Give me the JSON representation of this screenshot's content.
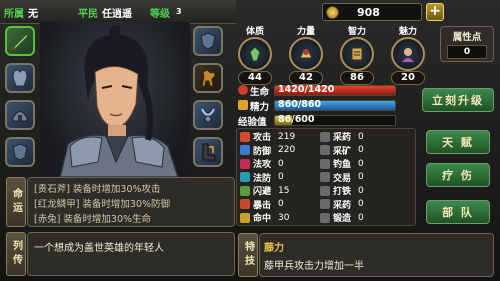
{
  "header": {
    "faction_label": "所属",
    "faction_value": "无",
    "rank_label": "平民",
    "title_value": "任逍遥",
    "level_label": "等级",
    "level_value": "3"
  },
  "currency": {
    "amount": "908",
    "add_label": "+"
  },
  "equipment_slots_left": [
    "weapon-icon",
    "armor-icon",
    "helmet-icon",
    "shield-icon"
  ],
  "equipment_slots_right": [
    "shield-icon",
    "horse-icon",
    "necklace-icon",
    "boots-icon"
  ],
  "attributes": [
    {
      "name": "体质",
      "value": "44"
    },
    {
      "name": "力量",
      "value": "42"
    },
    {
      "name": "智力",
      "value": "86"
    },
    {
      "name": "魅力",
      "value": "20"
    }
  ],
  "attr_points": {
    "label": "属性点",
    "value": "0"
  },
  "vitals": {
    "hp": {
      "label": "生命",
      "text": "1420/1420",
      "fraction": 1.0
    },
    "energy": {
      "label": "精力",
      "text": "860/860",
      "fraction": 1.0
    },
    "exp": {
      "label": "经验值",
      "text": "86/600",
      "fraction": 0.143
    }
  },
  "stats": [
    {
      "label": "攻击",
      "value": "219",
      "color": "#d24a2c"
    },
    {
      "label": "采药",
      "value": "0",
      "color": "#6a6a6a"
    },
    {
      "label": "防御",
      "value": "220",
      "color": "#3b7bd3"
    },
    {
      "label": "采矿",
      "value": "0",
      "color": "#6a6a6a"
    },
    {
      "label": "法攻",
      "value": "0",
      "color": "#c92a5a"
    },
    {
      "label": "钓鱼",
      "value": "0",
      "color": "#6a6a6a"
    },
    {
      "label": "法防",
      "value": "0",
      "color": "#2a9ab0"
    },
    {
      "label": "交易",
      "value": "0",
      "color": "#6a6a6a"
    },
    {
      "label": "闪避",
      "value": "15",
      "color": "#5a9c3a"
    },
    {
      "label": "打铁",
      "value": "0",
      "color": "#6a6a6a"
    },
    {
      "label": "暴击",
      "value": "0",
      "color": "#c94a2a"
    },
    {
      "label": "采药",
      "value": "0",
      "color": "#6a6a6a"
    },
    {
      "label": "命中",
      "value": "30",
      "color": "#c9a22a"
    },
    {
      "label": "锻造",
      "value": "0",
      "color": "#6a6a6a"
    }
  ],
  "buttons": {
    "upgrade": "立刻升级",
    "talent": "天 赋",
    "heal": "疗 伤",
    "troops": "部 队"
  },
  "fate": {
    "tab_label": "命运",
    "lines": [
      "[贵石斧] 装备时增加30%攻击",
      "[红龙鳞甲] 装备时增加30%防御",
      "[赤兔] 装备时增加30%生命"
    ]
  },
  "biography": {
    "tab_label": "列传",
    "text": "一个想成为盖世英雄的年轻人"
  },
  "special_skill": {
    "tab_label": "特技",
    "name": "藤力",
    "desc": "藤甲兵攻击力增加一半"
  }
}
